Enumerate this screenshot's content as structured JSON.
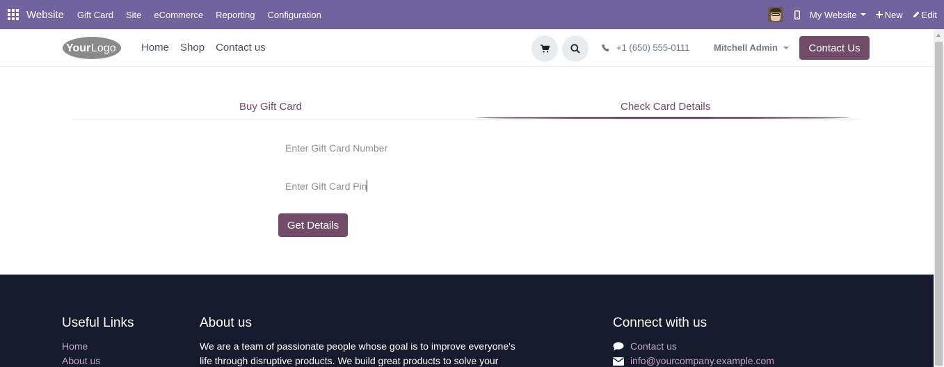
{
  "admin_bar": {
    "app_name": "Website",
    "menu": [
      "Gift Card",
      "Site",
      "eCommerce",
      "Reporting",
      "Configuration"
    ],
    "my_website": "My Website",
    "new": "New",
    "edit": "Edit",
    "color": "#71639e"
  },
  "header": {
    "nav": [
      "Home",
      "Shop",
      "Contact us"
    ],
    "phone": "+1 (650) 555-0111",
    "user": "Mitchell Admin",
    "contact_button": "Contact Us",
    "logo_text_1": "Your",
    "logo_text_2": "Logo",
    "brand_color": "#714b67"
  },
  "tabs": {
    "buy": "Buy Gift Card",
    "check": "Check Card Details",
    "active": "Check Card Details"
  },
  "form": {
    "number_placeholder": "Enter Gift Card Number",
    "pin_placeholder": "Enter Gift Card Pin",
    "number_value": "",
    "pin_value": "",
    "submit": "Get Details"
  },
  "footer": {
    "useful_links": {
      "title": "Useful Links",
      "items": [
        "Home",
        "About us"
      ]
    },
    "about": {
      "title": "About us",
      "text": "We are a team of passionate people whose goal is to improve everyone's life through disruptive products. We build great products to solve your"
    },
    "connect": {
      "title": "Connect with us",
      "items": [
        "Contact us",
        "info@yourcompany.example.com"
      ]
    },
    "background": "#151a2d",
    "link_color": "#c6a2c9"
  }
}
